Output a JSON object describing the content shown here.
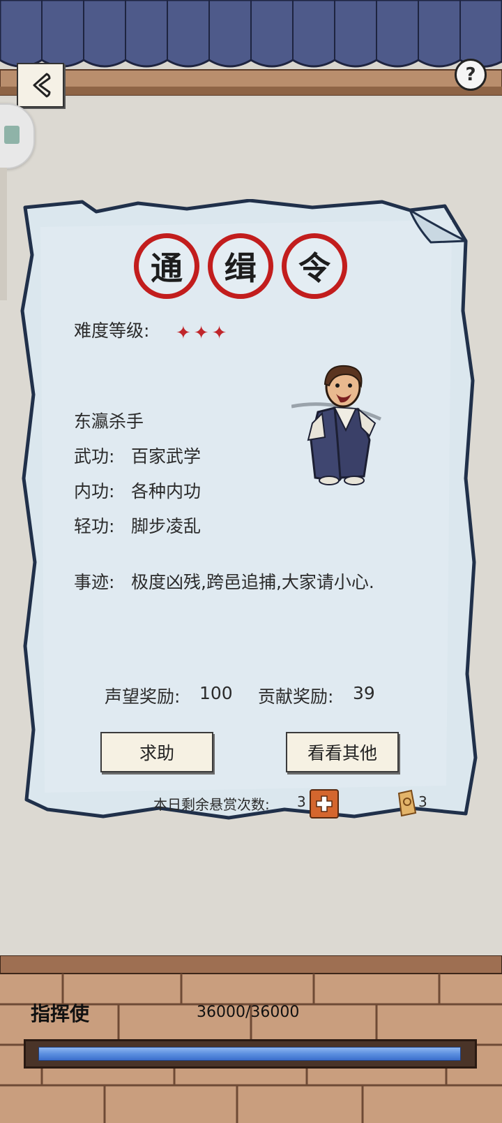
{
  "header": {
    "help_label": "?"
  },
  "wanted": {
    "stamps": [
      "通",
      "缉",
      "令"
    ],
    "difficulty_label": "难度等级:",
    "difficulty_stars": 3,
    "target_name": "东瀛杀手",
    "martial": {
      "label": "武功:",
      "value": "百家武学"
    },
    "inner": {
      "label": "内功:",
      "value": "各种内功"
    },
    "light": {
      "label": "轻功:",
      "value": "脚步凌乱"
    },
    "deeds": {
      "label": "事迹:",
      "value": "极度凶残,跨邑追捕,大家请小心."
    },
    "fame_reward": {
      "label": "声望奖励:",
      "value": "100"
    },
    "contrib_reward": {
      "label": "贡献奖励:",
      "value": "39"
    },
    "help_button": "求助",
    "others_button": "看看其他",
    "remaining_label": "本日剩余悬赏次数:",
    "remaining_count": "3",
    "token_count": "3"
  },
  "footer": {
    "rank_title": "指挥使",
    "progress_text": "36000/36000",
    "progress_fraction": 1.0
  },
  "colors": {
    "stamp_red": "#c21d1d",
    "paper_blue": "#dde9f0",
    "bar_blue": "#5b8fe0"
  }
}
